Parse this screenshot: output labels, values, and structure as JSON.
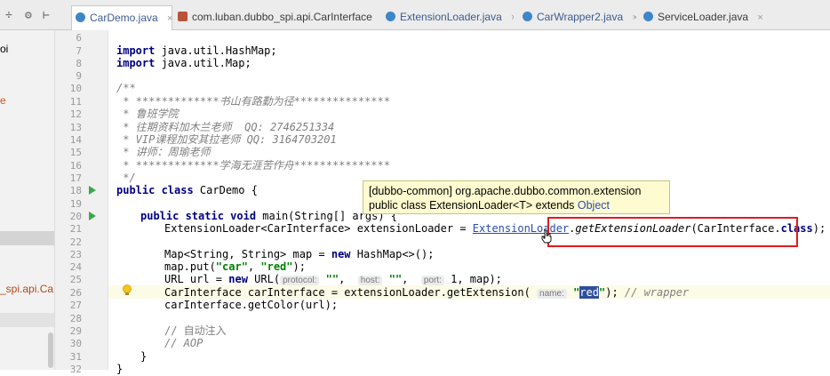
{
  "tabs": [
    {
      "label": "CarDemo.java",
      "kind": "class"
    },
    {
      "label": "com.luban.dubbo_spi.api.CarInterface",
      "kind": "interface"
    },
    {
      "label": "ExtensionLoader.java",
      "kind": "class"
    },
    {
      "label": "CarWrapper2.java",
      "kind": "class"
    },
    {
      "label": "ServiceLoader.java",
      "kind": "class"
    }
  ],
  "project_panel": {
    "frag1": "oi",
    "frag2": "e",
    "frag3": "_spi.api.Ca"
  },
  "line_numbers": [
    "6",
    "7",
    "8",
    "9",
    "10",
    "11",
    "12",
    "13",
    "14",
    "15",
    "16",
    "17",
    "18",
    "19",
    "20",
    "21",
    "22",
    "23",
    "24",
    "25",
    "26",
    "27",
    "28",
    "29",
    "30",
    "31",
    "32"
  ],
  "code": {
    "l7_kw": "import",
    "l7_rest": " java.util.HashMap;",
    "l8_kw": "import",
    "l8_rest": " java.util.Map;",
    "l10": "/**",
    "l11": " * *************书山有路勤为径***************",
    "l12": " * 鲁班学院",
    "l13": " * 往期资料加木兰老师  QQ: 2746251334",
    "l14": " * VIP课程加安其拉老师 QQ: 3164703201",
    "l15": " * 讲师：周瑜老师",
    "l16": " * *************学海无涯苦作舟***************",
    "l17": " */",
    "l18_kw": "public class",
    "l18_rest": " CarDemo {",
    "l20_kw": "public static void",
    "l20_rest": " main(String[] args) {",
    "l21_a": "ExtensionLoader<CarInterface> extensionLoader = ",
    "l21_link": "ExtensionLoader",
    "l21_b": ".",
    "l21_static": "getExtensionLoader",
    "l21_c": "(CarInterface.",
    "l21_kw": "class",
    "l21_d": "); //",
    "l23_a": "Map<String, String> map = ",
    "l23_kw": "new",
    "l23_b": " HashMap<>();",
    "l24_a": "map.put(",
    "l24_s1": "\"car\"",
    "l24_b": ", ",
    "l24_s2": "\"red\"",
    "l24_c": ");",
    "l25_a": "URL url = ",
    "l25_kw": "new",
    "l25_b": " URL(",
    "l25_h1": "protocol:",
    "l25_s1": "\"\"",
    "l25_c": ",  ",
    "l25_h2": "host:",
    "l25_s2": "\"\"",
    "l25_d": ",  ",
    "l25_h3": "port:",
    "l25_e": " 1, map);",
    "l26_a": "CarInterface carInterface = extensionLoader.getExtension( ",
    "l26_h": "name:",
    "l26_q1": "\"",
    "l26_sel": "red",
    "l26_q2": "\"",
    "l26_b": "); ",
    "l26_cmt": "// wrapper",
    "l27": "carInterface.getColor(url);",
    "l29": "// 自动注入",
    "l30": "// AOP",
    "l31": "}",
    "l32": "}"
  },
  "tooltip": {
    "line1": "[dubbo-common] org.apache.dubbo.common.extension",
    "line2a": "public class ExtensionLoader<T> extends ",
    "line2b": "Object"
  },
  "colors": {
    "keyword": "#000080",
    "string": "#008000",
    "comment": "#808080",
    "highlight_box": "#e01b1b"
  }
}
